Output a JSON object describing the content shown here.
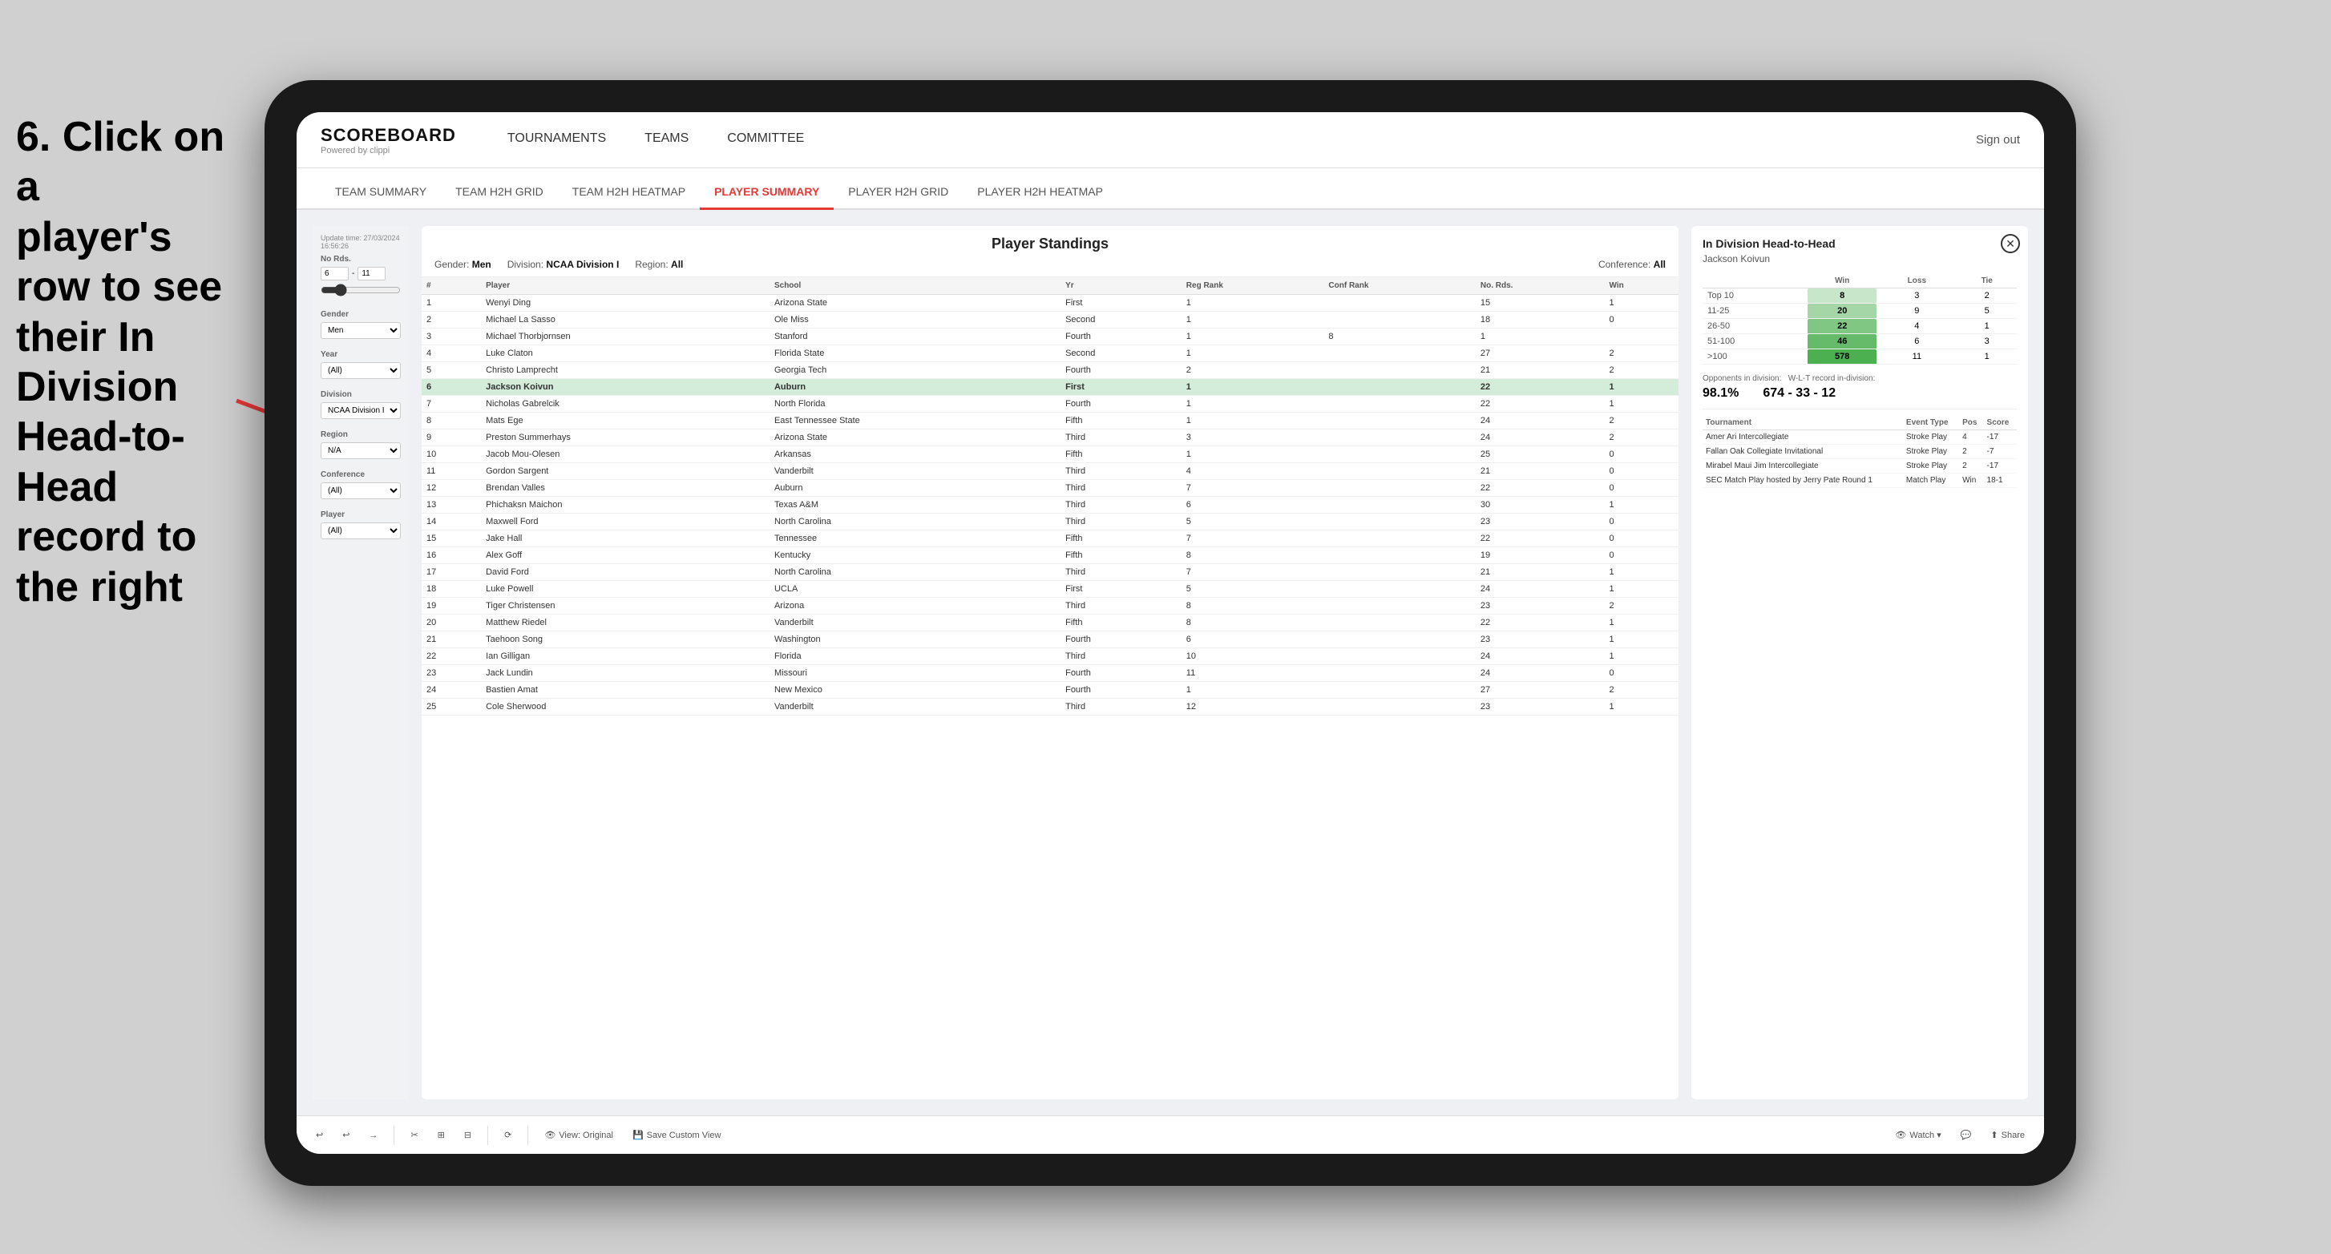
{
  "instruction": {
    "line1": "6. Click on a",
    "line2": "player's row to see",
    "line3": "their In Division",
    "line4": "Head-to-Head",
    "line5": "record to the right"
  },
  "nav": {
    "logo": "SCOREBOARD",
    "logo_sub": "Powered by clippi",
    "items": [
      "TOURNAMENTS",
      "TEAMS",
      "COMMITTEE"
    ],
    "sign_out": "Sign out"
  },
  "sub_nav": {
    "items": [
      "TEAM SUMMARY",
      "TEAM H2H GRID",
      "TEAM H2H HEATMAP",
      "PLAYER SUMMARY",
      "PLAYER H2H GRID",
      "PLAYER H2H HEATMAP"
    ],
    "active": "PLAYER SUMMARY"
  },
  "table": {
    "title": "Player Standings",
    "update_time": "Update time: 27/03/2024 16:56:26",
    "gender_label": "Gender:",
    "gender_value": "Men",
    "division_label": "Division:",
    "division_value": "NCAA Division I",
    "region_label": "Region:",
    "region_value": "All",
    "conference_label": "Conference:",
    "conference_value": "All",
    "columns": [
      "#",
      "Player",
      "School",
      "Yr",
      "Reg Rank",
      "Conf Rank",
      "No. Rds.",
      "Win"
    ],
    "rows": [
      {
        "rank": 1,
        "player": "Wenyi Ding",
        "school": "Arizona State",
        "yr": "First",
        "reg": 1,
        "conf": "",
        "rds": 15,
        "win": 1
      },
      {
        "rank": 2,
        "player": "Michael La Sasso",
        "school": "Ole Miss",
        "yr": "Second",
        "reg": 1,
        "conf": "",
        "rds": 18,
        "win": 0
      },
      {
        "rank": 3,
        "player": "Michael Thorbjornsen",
        "school": "Stanford",
        "yr": "Fourth",
        "reg": 1,
        "conf": 8,
        "rds": 1
      },
      {
        "rank": 4,
        "player": "Luke Claton",
        "school": "Florida State",
        "yr": "Second",
        "reg": 1,
        "conf": "",
        "rds": 27,
        "win": 2
      },
      {
        "rank": 5,
        "player": "Christo Lamprecht",
        "school": "Georgia Tech",
        "yr": "Fourth",
        "reg": 2,
        "conf": "",
        "rds": 21,
        "win": 2
      },
      {
        "rank": 6,
        "player": "Jackson Koivun",
        "school": "Auburn",
        "yr": "First",
        "reg": 1,
        "conf": "",
        "rds": 22,
        "win": 1,
        "highlighted": true
      },
      {
        "rank": 7,
        "player": "Nicholas Gabrelcik",
        "school": "North Florida",
        "yr": "Fourth",
        "reg": 1,
        "conf": "",
        "rds": 22,
        "win": 1
      },
      {
        "rank": 8,
        "player": "Mats Ege",
        "school": "East Tennessee State",
        "yr": "Fifth",
        "reg": 1,
        "conf": "",
        "rds": 24,
        "win": 2
      },
      {
        "rank": 9,
        "player": "Preston Summerhays",
        "school": "Arizona State",
        "yr": "Third",
        "reg": 3,
        "conf": "",
        "rds": 24,
        "win": 2
      },
      {
        "rank": 10,
        "player": "Jacob Mou-Olesen",
        "school": "Arkansas",
        "yr": "Fifth",
        "reg": 1,
        "conf": "",
        "rds": 25,
        "win": 0
      },
      {
        "rank": 11,
        "player": "Gordon Sargent",
        "school": "Vanderbilt",
        "yr": "Third",
        "reg": 4,
        "conf": "",
        "rds": 21,
        "win": 0
      },
      {
        "rank": 12,
        "player": "Brendan Valles",
        "school": "Auburn",
        "yr": "Third",
        "reg": 7,
        "conf": "",
        "rds": 22,
        "win": 0
      },
      {
        "rank": 13,
        "player": "Phichaksn Maichon",
        "school": "Texas A&M",
        "yr": "Third",
        "reg": 6,
        "conf": "",
        "rds": 30,
        "win": 1
      },
      {
        "rank": 14,
        "player": "Maxwell Ford",
        "school": "North Carolina",
        "yr": "Third",
        "reg": 5,
        "conf": "",
        "rds": 23,
        "win": 0
      },
      {
        "rank": 15,
        "player": "Jake Hall",
        "school": "Tennessee",
        "yr": "Fifth",
        "reg": 7,
        "conf": "",
        "rds": 22,
        "win": 0
      },
      {
        "rank": 16,
        "player": "Alex Goff",
        "school": "Kentucky",
        "yr": "Fifth",
        "reg": 8,
        "conf": "",
        "rds": 19,
        "win": 0
      },
      {
        "rank": 17,
        "player": "David Ford",
        "school": "North Carolina",
        "yr": "Third",
        "reg": 7,
        "conf": "",
        "rds": 21,
        "win": 1
      },
      {
        "rank": 18,
        "player": "Luke Powell",
        "school": "UCLA",
        "yr": "First",
        "reg": 5,
        "conf": "",
        "rds": 24,
        "win": 1
      },
      {
        "rank": 19,
        "player": "Tiger Christensen",
        "school": "Arizona",
        "yr": "Third",
        "reg": 8,
        "conf": "",
        "rds": 23,
        "win": 2
      },
      {
        "rank": 20,
        "player": "Matthew Riedel",
        "school": "Vanderbilt",
        "yr": "Fifth",
        "reg": 8,
        "conf": "",
        "rds": 22,
        "win": 1
      },
      {
        "rank": 21,
        "player": "Taehoon Song",
        "school": "Washington",
        "yr": "Fourth",
        "reg": 6,
        "conf": "",
        "rds": 23,
        "win": 1
      },
      {
        "rank": 22,
        "player": "Ian Gilligan",
        "school": "Florida",
        "yr": "Third",
        "reg": 10,
        "conf": "",
        "rds": 24,
        "win": 1
      },
      {
        "rank": 23,
        "player": "Jack Lundin",
        "school": "Missouri",
        "yr": "Fourth",
        "reg": 11,
        "conf": "",
        "rds": 24,
        "win": 0
      },
      {
        "rank": 24,
        "player": "Bastien Amat",
        "school": "New Mexico",
        "yr": "Fourth",
        "reg": 1,
        "conf": "",
        "rds": 27,
        "win": 2
      },
      {
        "rank": 25,
        "player": "Cole Sherwood",
        "school": "Vanderbilt",
        "yr": "Third",
        "reg": 12,
        "conf": "",
        "rds": 23,
        "win": 1
      }
    ]
  },
  "filters": {
    "no_rds_label": "No Rds.",
    "no_rds_min": "6",
    "no_rds_max": "11",
    "gender_label": "Gender",
    "gender_value": "Men",
    "year_label": "Year",
    "year_value": "(All)",
    "division_label": "Division",
    "division_value": "NCAA Division I",
    "region_label": "Region",
    "region_value": "N/A",
    "conference_label": "Conference",
    "conference_value": "(All)",
    "player_label": "Player",
    "player_value": "(All)"
  },
  "h2h": {
    "title": "In Division Head-to-Head",
    "player": "Jackson Koivun",
    "rows": [
      {
        "range": "Top 10",
        "win": 8,
        "loss": 3,
        "tie": 2
      },
      {
        "range": "11-25",
        "win": 20,
        "loss": 9,
        "tie": 5
      },
      {
        "range": "26-50",
        "win": 22,
        "loss": 4,
        "tie": 1
      },
      {
        "range": "51-100",
        "win": 46,
        "loss": 6,
        "tie": 3
      },
      {
        "range": ">100",
        "win": 578,
        "loss": 11,
        "tie": 1
      }
    ],
    "opponents_pct_label": "Opponents in division:",
    "opponents_pct": "98.1%",
    "record_label": "W-L-T record in-division:",
    "record": "674 - 33 - 12",
    "tournaments": [
      {
        "name": "Amer Ari Intercollegiate",
        "type": "Stroke Play",
        "pos": 4,
        "score": "-17"
      },
      {
        "name": "Fallan Oak Collegiate Invitational",
        "type": "Stroke Play",
        "pos": 2,
        "score": "-7"
      },
      {
        "name": "Mirabel Maui Jim Intercollegiate",
        "type": "Stroke Play",
        "pos": 2,
        "score": "-17"
      },
      {
        "name": "SEC Match Play hosted by Jerry Pate Round 1",
        "type": "Match Play",
        "pos": "Win",
        "score": "18-1"
      }
    ],
    "tournament_cols": [
      "Tournament",
      "Event Type",
      "Pos",
      "Score"
    ]
  },
  "toolbar": {
    "undo": "↩",
    "redo": "↪",
    "forward": "→",
    "view_original": "View: Original",
    "save_custom": "Save Custom View",
    "watch": "Watch ▾",
    "share": "Share"
  }
}
